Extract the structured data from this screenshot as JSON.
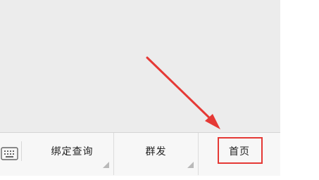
{
  "menu": {
    "keyboard_icon": "keyboard-icon",
    "items": [
      {
        "label": "绑定查询",
        "has_submenu": true
      },
      {
        "label": "群发",
        "has_submenu": true
      },
      {
        "label": "首页",
        "has_submenu": false
      }
    ]
  },
  "annotation": {
    "color": "#e53935",
    "target": "首页"
  }
}
